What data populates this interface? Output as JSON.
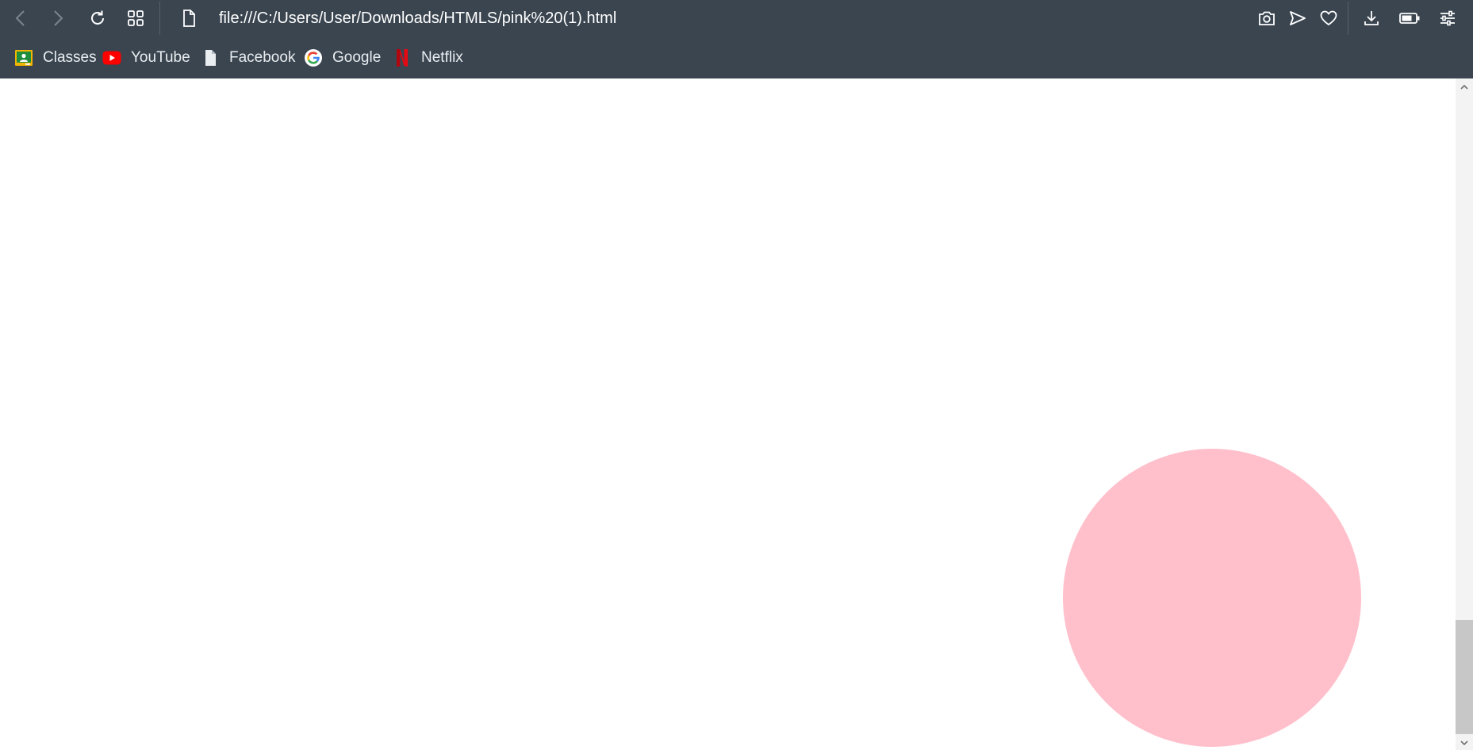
{
  "toolbar": {
    "url": "file:///C:/Users/User/Downloads/HTMLS/pink%20(1).html",
    "nav_icons": [
      "chevron-left-icon",
      "chevron-right-icon",
      "reload-icon",
      "grid-icon",
      "file-icon"
    ],
    "action_icons": [
      "camera-icon",
      "send-icon",
      "heart-icon",
      "download-icon",
      "battery-icon",
      "sliders-icon"
    ]
  },
  "bookmarks": [
    {
      "label": "Classes",
      "icon": "classroom-icon"
    },
    {
      "label": "YouTube",
      "icon": "youtube-icon"
    },
    {
      "label": "Facebook",
      "icon": "file-icon"
    },
    {
      "label": "Google",
      "icon": "google-icon"
    },
    {
      "label": "Netflix",
      "icon": "netflix-icon"
    }
  ],
  "page": {
    "circle_color": "#ffc0cb"
  },
  "colors": {
    "chrome": "#3a4550",
    "page_background": "#ffffff"
  }
}
